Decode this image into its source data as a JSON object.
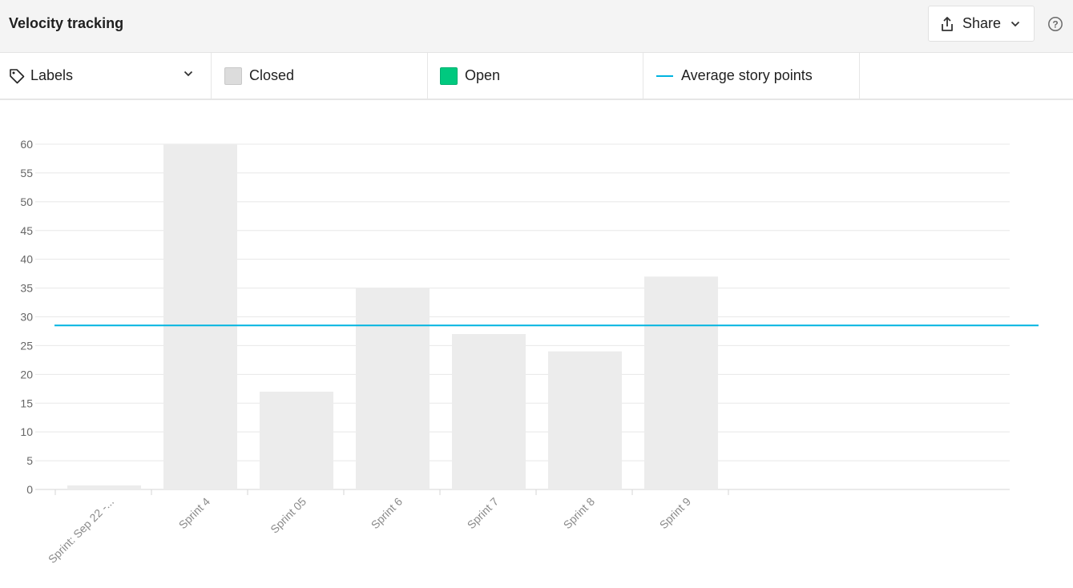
{
  "header": {
    "title": "Velocity tracking",
    "share_label": "Share",
    "share_icon": "share-icon",
    "help_icon": "help-icon"
  },
  "legend": {
    "labels_label": "Labels",
    "closed_label": "Closed",
    "open_label": "Open",
    "average_label": "Average story points"
  },
  "colors": {
    "closed": "#ececec",
    "open": "#00c97f",
    "average": "#00b4e0"
  },
  "chart_data": {
    "type": "bar",
    "categories": [
      "Sprint: Sep 22 -...",
      "Sprint 4",
      "Sprint 05",
      "Sprint 6",
      "Sprint 7",
      "Sprint 8",
      "Sprint 9"
    ],
    "series": [
      {
        "name": "Closed",
        "values": [
          0.7,
          60,
          17,
          35,
          27,
          24,
          37
        ]
      },
      {
        "name": "Open",
        "values": [
          0,
          0,
          0,
          0,
          0,
          0,
          0
        ]
      }
    ],
    "average": {
      "name": "Average story points",
      "value": 28.5
    },
    "ylim": [
      0,
      60
    ],
    "yticks": [
      0,
      5,
      10,
      15,
      20,
      25,
      30,
      35,
      40,
      45,
      50,
      55,
      60
    ],
    "grid": true,
    "legend_position": "top"
  }
}
